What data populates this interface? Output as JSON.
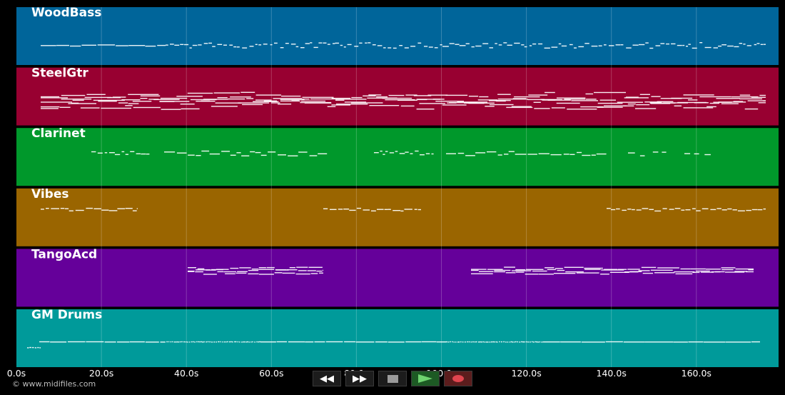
{
  "tracks": [
    {
      "name": "WoodBass",
      "color": "#00659a"
    },
    {
      "name": "SteelGtr",
      "color": "#980031"
    },
    {
      "name": "Clarinet",
      "color": "#00982b"
    },
    {
      "name": "Vibes",
      "color": "#9a6500"
    },
    {
      "name": "TangoAcd",
      "color": "#65009a"
    },
    {
      "name": "GM Drums",
      "color": "#009a9a"
    }
  ],
  "time_axis": {
    "unit": "s",
    "ticks": [
      "0.0s",
      "20.0s",
      "40.0s",
      "60.0s",
      "80.0s",
      "100.0s",
      "120.0s",
      "140.0s",
      "160.0s"
    ]
  },
  "transport": {
    "rewind_icon": "◀◀",
    "forward_icon": "▶▶",
    "buttons": [
      "rewind-icon",
      "fast-forward-icon",
      "stop-icon",
      "play-icon",
      "record-icon"
    ]
  },
  "copyright": "© www.midifiles.com"
}
